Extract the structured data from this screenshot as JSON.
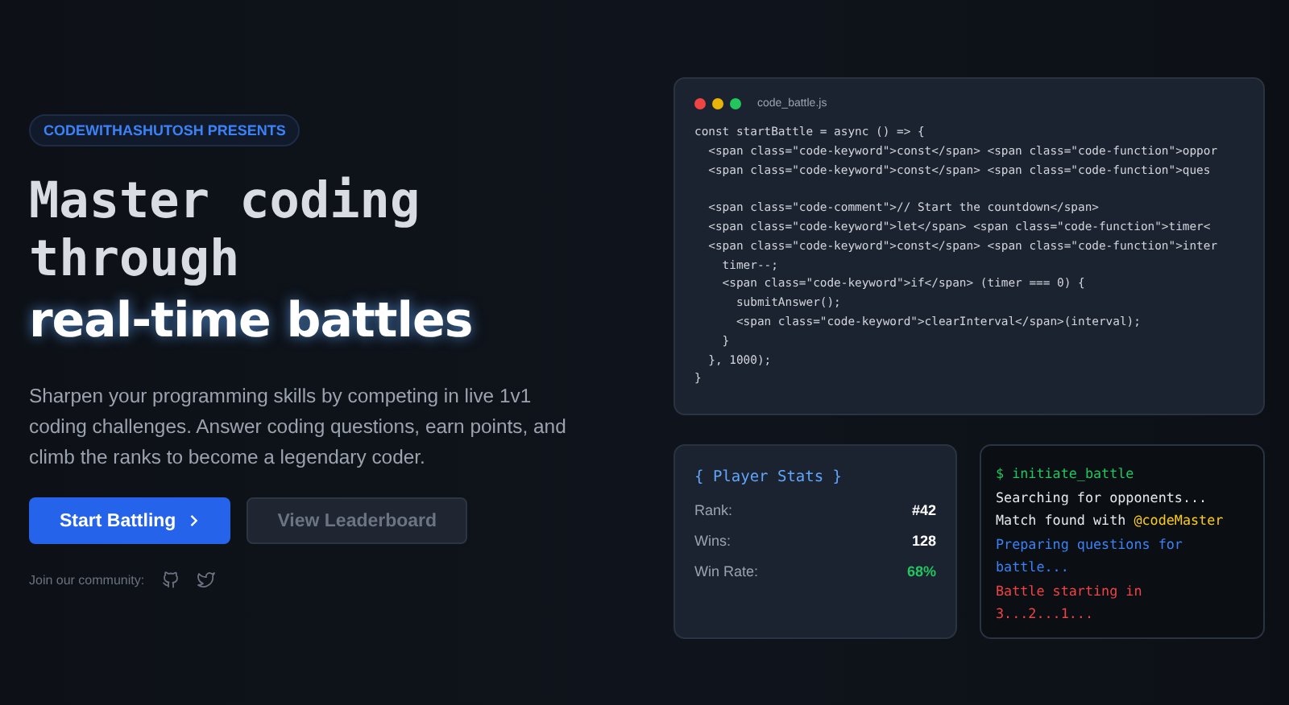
{
  "hero": {
    "badge": "CODEWITHASHUTOSH PRESENTS",
    "title_lines": [
      "Master coding",
      "through"
    ],
    "title_highlight": "real-time battles",
    "description": "Sharpen your programming skills by competing in live 1v1 coding challenges. Answer coding questions, earn points, and climb the ranks to become a legendary coder.",
    "buttons": [
      {
        "label": "Start Battling",
        "kind": "primary",
        "disabled": false
      },
      {
        "label": "View Leaderboard",
        "kind": "secondary",
        "disabled": true
      }
    ],
    "community_label": "Join our community:"
  },
  "code_window": {
    "filename": "code_battle.js",
    "blocks": [
      {
        "lines": [
          "const startBattle = async () => {",
          "  <span class=\"code-keyword\">const</span> <span class=\"code-function\">oppor",
          "  <span class=\"code-keyword\">const</span> <span class=\"code-function\">ques"
        ]
      },
      {
        "lines": [
          "  <span class=\"code-comment\">// Start the countdown</span>",
          "  <span class=\"code-keyword\">let</span> <span class=\"code-function\">timer<",
          "  <span class=\"code-keyword\">const</span> <span class=\"code-function\">inter",
          "    timer--;",
          "    <span class=\"code-keyword\">if</span> (timer === 0) {",
          "      submitAnswer();",
          "      <span class=\"code-keyword\">clearInterval</span>(interval);",
          "    }",
          "  }, 1000);",
          "}"
        ]
      }
    ]
  },
  "player_stats": {
    "title": "{ Player Stats }",
    "rows": [
      {
        "label": "Rank:",
        "value": "#42",
        "kind": "plain"
      },
      {
        "label": "Wins:",
        "value": "128",
        "kind": "plain"
      },
      {
        "label": "Win Rate:",
        "value": "68%",
        "kind": "positive"
      }
    ]
  },
  "terminal": {
    "lines": [
      {
        "kind": "command",
        "text": "$ initiate_battle"
      },
      {
        "kind": "output",
        "text": "Searching for opponents..."
      },
      {
        "kind": "output",
        "text": "Match found with ",
        "mention": "@codeMaster"
      },
      {
        "kind": "progress",
        "text": "Preparing questions for battle..."
      },
      {
        "kind": "alert",
        "text": "Battle starting in 3...2...1..."
      }
    ]
  }
}
